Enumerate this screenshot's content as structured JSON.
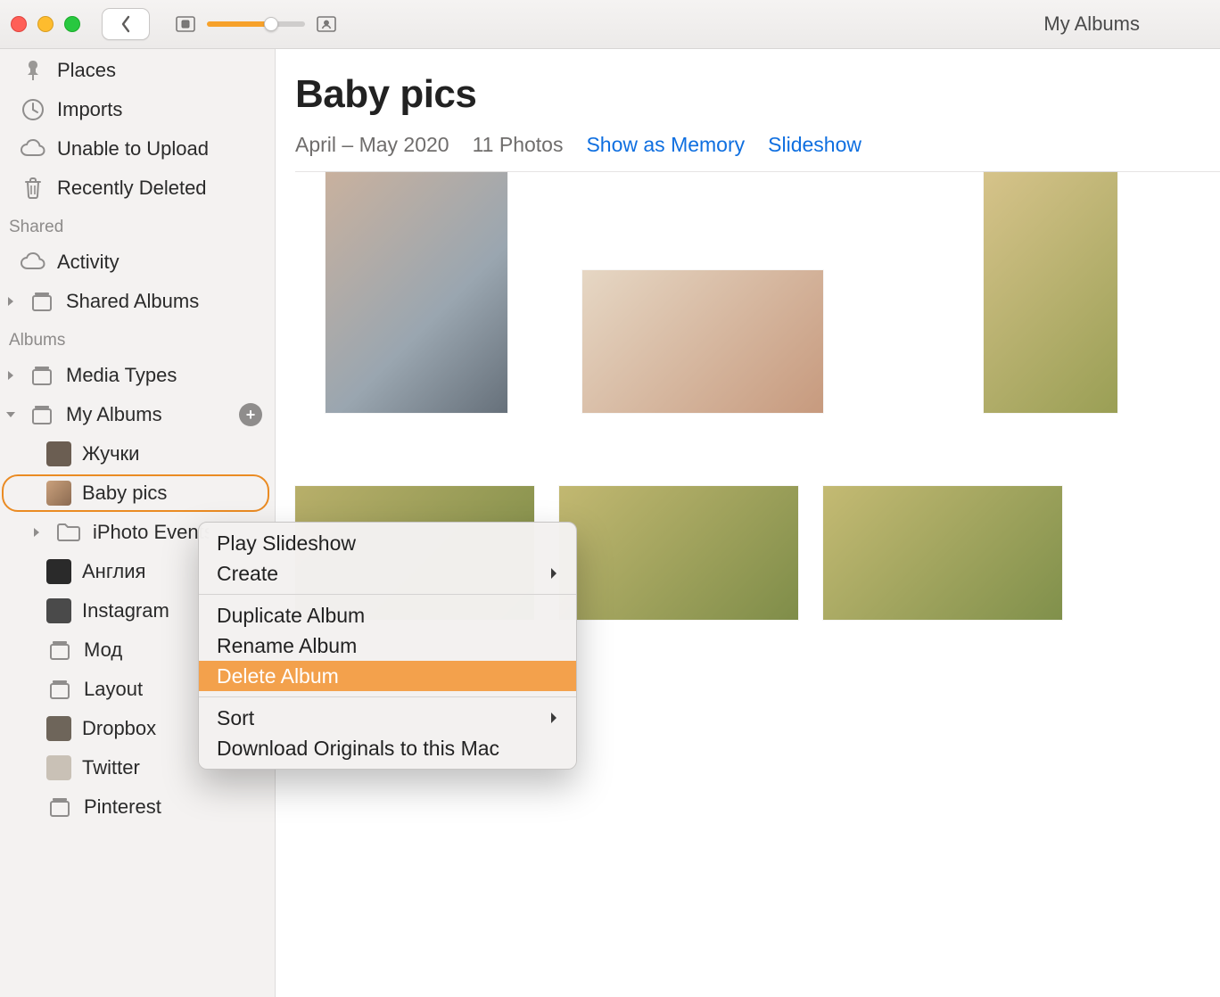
{
  "toolbar": {
    "title": "My Albums"
  },
  "sidebar": {
    "top": [
      {
        "label": "Places"
      },
      {
        "label": "Imports"
      },
      {
        "label": "Unable to Upload"
      },
      {
        "label": "Recently Deleted"
      }
    ],
    "shared_label": "Shared",
    "shared": [
      {
        "label": "Activity"
      },
      {
        "label": "Shared Albums"
      }
    ],
    "albums_label": "Albums",
    "media_types_label": "Media Types",
    "my_albums_label": "My Albums",
    "my_albums": [
      {
        "label": "Жучки"
      },
      {
        "label": "Baby pics"
      },
      {
        "label": "iPhoto Events"
      },
      {
        "label": "Англия"
      },
      {
        "label": "Instagram"
      },
      {
        "label": "Мод"
      },
      {
        "label": "Layout"
      },
      {
        "label": "Dropbox"
      },
      {
        "label": "Twitter"
      },
      {
        "label": "Pinterest"
      }
    ]
  },
  "album": {
    "title": "Baby pics",
    "date_range": "April – May 2020",
    "count": "11 Photos",
    "show_as_memory": "Show as Memory",
    "slideshow": "Slideshow"
  },
  "context_menu": {
    "play_slideshow": "Play Slideshow",
    "create": "Create",
    "duplicate": "Duplicate Album",
    "rename": "Rename Album",
    "delete": "Delete Album",
    "sort": "Sort",
    "download": "Download Originals to this Mac"
  }
}
